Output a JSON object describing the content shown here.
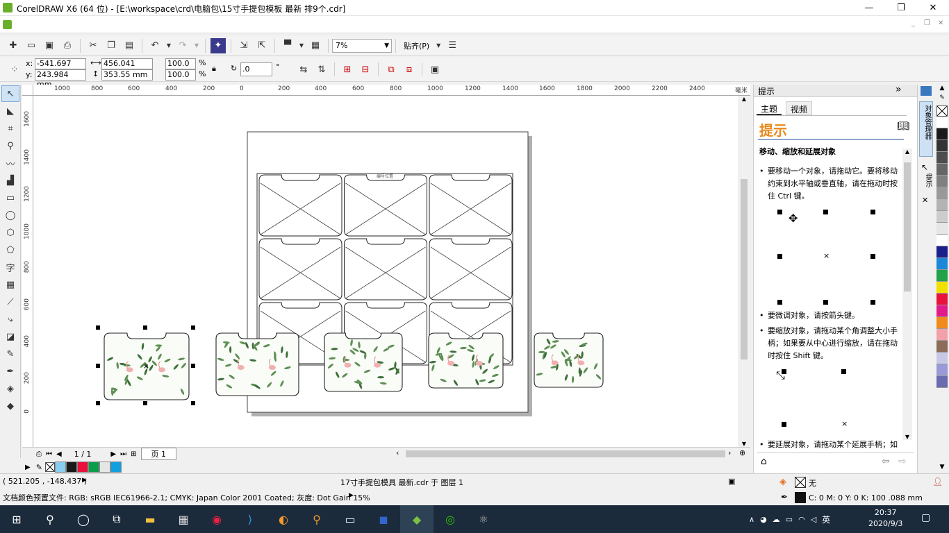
{
  "window": {
    "title": "CorelDRAW X6 (64 位) - [E:\\workspace\\crd\\电脑包\\15寸手提包模板 最新 排9个.cdr]",
    "minimize": "—",
    "restore": "❐",
    "close": "✕",
    "doc_minimize": "_",
    "doc_restore": "❐",
    "doc_close": "✕"
  },
  "toolbar": {
    "zoom_value": "7%",
    "snap_label": "贴齐(P)"
  },
  "property_bar": {
    "x_label": "x:",
    "x_value": "-541.697 mm",
    "y_label": "y:",
    "y_value": "243.984 mm",
    "width_value": "456.041 mm",
    "height_value": "353.55 mm",
    "scale_x": "100.0",
    "scale_y": "100.0",
    "percent": "%",
    "rotation": ".0",
    "degree": "°"
  },
  "ruler_h": [
    "1000",
    "800",
    "600",
    "400",
    "200",
    "0",
    "200",
    "400",
    "600",
    "800",
    "1000",
    "1200",
    "1400",
    "1600",
    "1800",
    "2000",
    "2200",
    "2400"
  ],
  "ruler_h_unit": "毫米",
  "ruler_v": [
    "1600",
    "1400",
    "1200",
    "1000",
    "800",
    "600",
    "400",
    "200",
    "0"
  ],
  "canvas": {
    "template_label": "编号位置"
  },
  "docker": {
    "header": "提示",
    "tab_topics": "主题",
    "tab_video": "视频",
    "heading": "提示",
    "section_title": "移动、缩放和延展对象",
    "hint1": "要移动一个对象，请拖动它。要将移动约束到水平轴或垂直轴，请在拖动时按住 Ctrl 键。",
    "hint2": "要微调对象，请按箭头键。",
    "hint3": "要缩放对象，请拖动某个角调整大小手柄；如果要从中心进行缩放，请在拖动时按住 Shift 键。",
    "hint4": "要延展对象，请拖动某个延展手柄；如果要从中心进行延展，请在拖动时"
  },
  "side_tabs": {
    "object_manager": "对象管理器",
    "hints": "提示"
  },
  "page_nav": {
    "page_count": "1 / 1",
    "page_tab": "页 1"
  },
  "statusbar": {
    "coords": "( 521.205 , -148.437 )",
    "doc_info": "17寸手提包模具 最新.cdr 于 图层 1",
    "color_profile": "文档颜色预置文件: RGB: sRGB IEC61966-2.1; CMYK: Japan Color 2001 Coated; 灰度: Dot Gain 15%",
    "fill_none": "无",
    "outline_info": "C: 0 M: 0 Y: 0 K: 100  .088 mm"
  },
  "palette_colors": [
    "#ffffff",
    "#1a1a1a",
    "#333333",
    "#4d4d4d",
    "#666666",
    "#808080",
    "#999999",
    "#b3b3b3",
    "#cccccc",
    "#e6e6e6",
    "#ffffff",
    "#1b1f8c",
    "#1e88d8",
    "#22a34a",
    "#f0e000",
    "#e8123c",
    "#e31b8a",
    "#f08a1c",
    "#f2a1a8",
    "#8c6b5a",
    "#c8c8e6",
    "#9a9ad8",
    "#6b6bb0"
  ],
  "doc_palette_colors": [
    "#87cef0",
    "#1a1a1a",
    "#e8123c",
    "#0a9e4a",
    "#e6e6e6",
    "#10a0e0"
  ],
  "taskbar": {
    "time": "20:37",
    "date": "2020/9/3",
    "ime": "英"
  }
}
